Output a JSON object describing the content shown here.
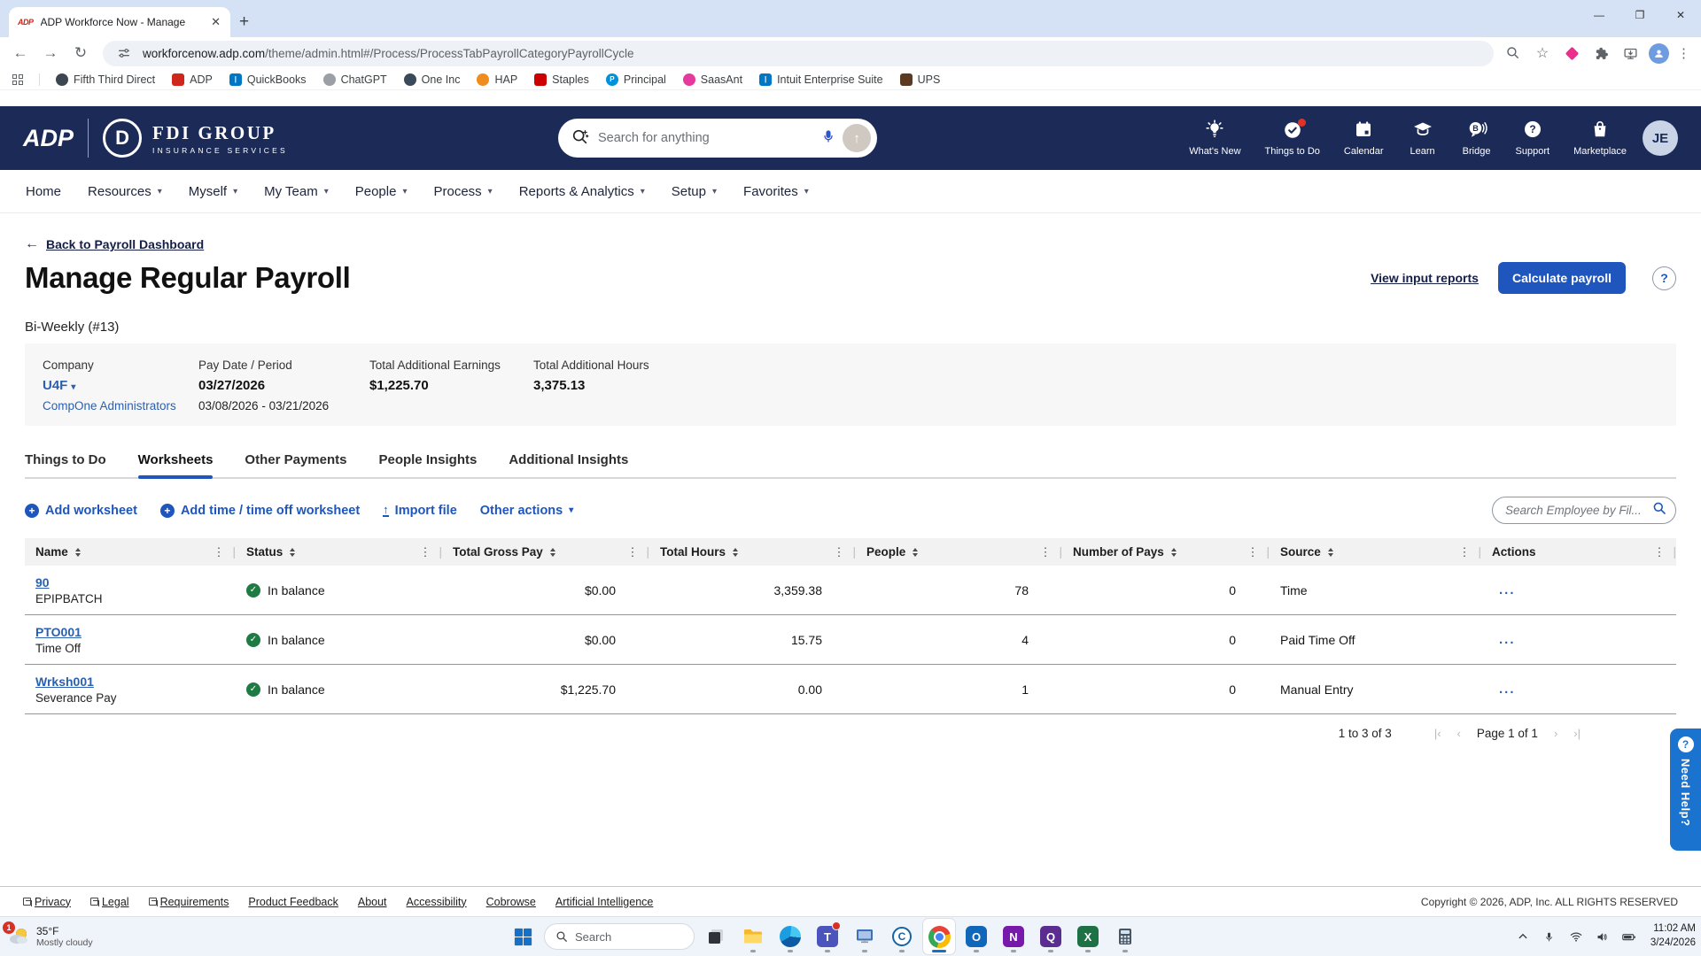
{
  "colors": {
    "header_navy": "#1b2a57",
    "accent_blue": "#1e56bd",
    "link_blue": "#2c5fae",
    "status_green": "#1e7b43",
    "need_help_blue": "#1a73cf"
  },
  "browser": {
    "tab_title": "ADP Workforce Now - Manage",
    "url_domain": "workforcenow.adp.com",
    "url_path": "/theme/admin.html#/Process/ProcessTabPayrollCategoryPayrollCycle",
    "bookmarks": [
      {
        "label": "Fifth Third Direct",
        "color": "#3c4650",
        "round": true,
        "glyph": ""
      },
      {
        "label": "ADP",
        "color": "#d0271d",
        "round": false,
        "glyph": ""
      },
      {
        "label": "QuickBooks",
        "color": "#0077c5",
        "round": false,
        "glyph": "|"
      },
      {
        "label": "ChatGPT",
        "color": "#9aa0a6",
        "round": true,
        "glyph": ""
      },
      {
        "label": "One Inc",
        "color": "#3b4a5a",
        "round": true,
        "glyph": ""
      },
      {
        "label": "HAP",
        "color": "#f08b1d",
        "round": true,
        "glyph": ""
      },
      {
        "label": "Staples",
        "color": "#cc0000",
        "round": false,
        "glyph": ""
      },
      {
        "label": "Principal",
        "color": "#0091da",
        "round": true,
        "glyph": "P"
      },
      {
        "label": "SaasAnt",
        "color": "#e5399e",
        "round": true,
        "glyph": ""
      },
      {
        "label": "Intuit Enterprise Suite",
        "color": "#0077c5",
        "round": false,
        "glyph": "|"
      },
      {
        "label": "UPS",
        "color": "#5b3a21",
        "round": false,
        "glyph": ""
      }
    ]
  },
  "header": {
    "adp_logo_text": "ADP",
    "fdi_circle_letter": "D",
    "company_name": "FDI GROUP",
    "company_tagline": "INSURANCE SERVICES",
    "search_placeholder": "Search for anything",
    "nav_icons": [
      {
        "label": "What's New",
        "icon": "whats-new",
        "badge": false
      },
      {
        "label": "Things to Do",
        "icon": "things-to-do",
        "badge": true
      },
      {
        "label": "Calendar",
        "icon": "calendar",
        "badge": false
      },
      {
        "label": "Learn",
        "icon": "learn",
        "badge": false
      },
      {
        "label": "Bridge",
        "icon": "bridge",
        "badge": false
      },
      {
        "label": "Support",
        "icon": "support",
        "badge": false
      },
      {
        "label": "Marketplace",
        "icon": "marketplace",
        "badge": false
      }
    ],
    "avatar_initials": "JE"
  },
  "nav": {
    "items": [
      {
        "label": "Home",
        "dropdown": false
      },
      {
        "label": "Resources",
        "dropdown": true
      },
      {
        "label": "Myself",
        "dropdown": true
      },
      {
        "label": "My Team",
        "dropdown": true
      },
      {
        "label": "People",
        "dropdown": true
      },
      {
        "label": "Process",
        "dropdown": true
      },
      {
        "label": "Reports & Analytics",
        "dropdown": true
      },
      {
        "label": "Setup",
        "dropdown": true
      },
      {
        "label": "Favorites",
        "dropdown": true
      }
    ]
  },
  "page": {
    "back_link": "Back to Payroll Dashboard",
    "title": "Manage Regular Payroll",
    "view_reports_link": "View input reports",
    "calculate_button": "Calculate payroll",
    "help_glyph": "?",
    "cycle_label": "Bi-Weekly (#13)",
    "summary": {
      "company_label": "Company",
      "company_value": "U4F",
      "company_sub": "CompOne Administrators",
      "pay_date_label": "Pay Date / Period",
      "pay_date_value": "03/27/2026",
      "pay_period": "03/08/2026 - 03/21/2026",
      "earnings_label": "Total Additional Earnings",
      "earnings_value": "$1,225.70",
      "hours_label": "Total Additional Hours",
      "hours_value": "3,375.13"
    },
    "tabs": [
      {
        "label": "Things to Do",
        "active": false
      },
      {
        "label": "Worksheets",
        "active": true
      },
      {
        "label": "Other Payments",
        "active": false
      },
      {
        "label": "People Insights",
        "active": false
      },
      {
        "label": "Additional Insights",
        "active": false
      }
    ],
    "toolbar": {
      "add_worksheet": "Add worksheet",
      "add_time": "Add time / time off worksheet",
      "import_file": "Import file",
      "other_actions": "Other actions",
      "search_placeholder": "Search Employee by Fil..."
    },
    "table": {
      "columns": [
        {
          "label": "Name",
          "sortable": true
        },
        {
          "label": "Status",
          "sortable": true
        },
        {
          "label": "Total Gross Pay",
          "sortable": true
        },
        {
          "label": "Total Hours",
          "sortable": true
        },
        {
          "label": "People",
          "sortable": true
        },
        {
          "label": "Number of Pays",
          "sortable": true
        },
        {
          "label": "Source",
          "sortable": true
        },
        {
          "label": "Actions",
          "sortable": false
        }
      ],
      "rows": [
        {
          "name": "90",
          "subtitle": "EPIPBATCH",
          "status": "In balance",
          "total_gross_pay": "$0.00",
          "total_hours": "3,359.38",
          "people": "78",
          "number_of_pays": "0",
          "source": "Time",
          "actions": "..."
        },
        {
          "name": "PTO001",
          "subtitle": "Time Off",
          "status": "In balance",
          "total_gross_pay": "$0.00",
          "total_hours": "15.75",
          "people": "4",
          "number_of_pays": "0",
          "source": "Paid Time Off",
          "actions": "..."
        },
        {
          "name": "Wrksh001",
          "subtitle": "Severance Pay",
          "status": "In balance",
          "total_gross_pay": "$1,225.70",
          "total_hours": "0.00",
          "people": "1",
          "number_of_pays": "0",
          "source": "Manual Entry",
          "actions": "..."
        }
      ]
    },
    "pagination": {
      "range": "1 to 3 of 3",
      "page": "Page 1 of 1",
      "first": "|‹",
      "prev": "‹",
      "next": "›",
      "last": "›|"
    },
    "need_help": "Need Help?"
  },
  "footer": {
    "links": [
      {
        "label": "Privacy",
        "icon": true
      },
      {
        "label": "Legal",
        "icon": true
      },
      {
        "label": "Requirements",
        "icon": true
      },
      {
        "label": "Product Feedback",
        "icon": false
      },
      {
        "label": "About",
        "icon": false
      },
      {
        "label": "Accessibility",
        "icon": false
      },
      {
        "label": "Cobrowse",
        "icon": false
      },
      {
        "label": "Artificial Intelligence",
        "icon": false
      }
    ],
    "copyright": "Copyright © 2026, ADP, Inc. ALL RIGHTS RESERVED"
  },
  "taskbar": {
    "weather_badge": "1",
    "weather_temp": "35°F",
    "weather_condition": "Mostly cloudy",
    "search_placeholder": "Search",
    "apps": [
      {
        "name": "task-view",
        "dot": false,
        "active": false
      },
      {
        "name": "file-explorer",
        "dot": true,
        "active": false
      },
      {
        "name": "edge",
        "dot": true,
        "active": false
      },
      {
        "name": "teams",
        "dot": true,
        "active": false
      },
      {
        "name": "remote-desktop",
        "dot": true,
        "active": false
      },
      {
        "name": "c-app",
        "dot": true,
        "active": false
      },
      {
        "name": "chrome",
        "dot": false,
        "active": true
      },
      {
        "name": "outlook",
        "dot": true,
        "active": false
      },
      {
        "name": "onenote",
        "dot": true,
        "active": false
      },
      {
        "name": "q-app",
        "dot": true,
        "active": false
      },
      {
        "name": "excel",
        "dot": true,
        "active": false
      },
      {
        "name": "calculator",
        "dot": true,
        "active": false
      }
    ],
    "time": "11:02 AM",
    "date": "3/24/2026"
  }
}
